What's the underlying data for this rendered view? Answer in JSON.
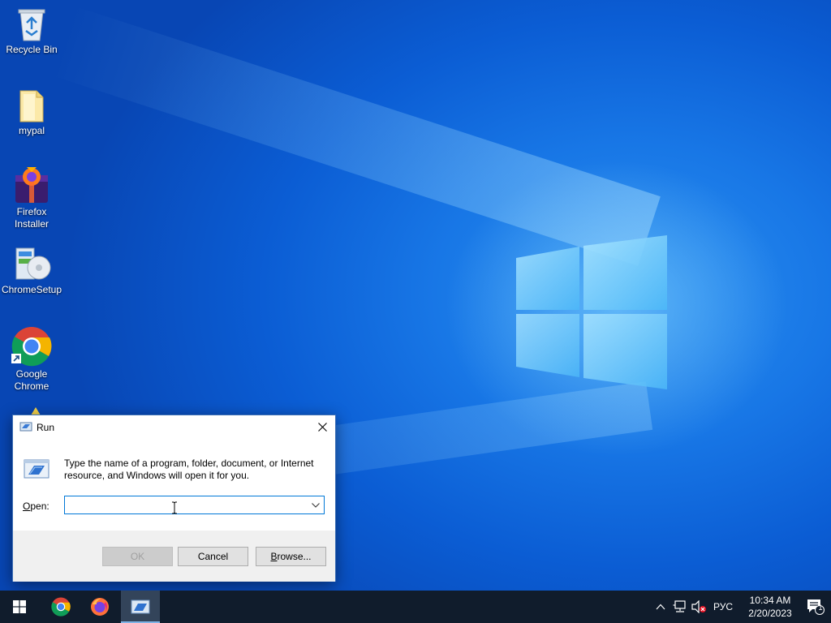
{
  "desktop": {
    "icons": [
      {
        "label": "Recycle Bin",
        "icon": "recycle-bin-icon"
      },
      {
        "label": "mypal",
        "icon": "folder-icon"
      },
      {
        "label": "Firefox Installer",
        "icon": "firefox-installer-icon"
      },
      {
        "label": "ChromeSetup",
        "icon": "chrome-setup-icon"
      },
      {
        "label": "Google Chrome",
        "icon": "google-chrome-icon"
      }
    ]
  },
  "run_dialog": {
    "title": "Run",
    "description": "Type the name of a program, folder, document, or Internet resource, and Windows will open it for you.",
    "open_label_mnemonic": "O",
    "open_label_rest": "pen:",
    "open_value": "",
    "ok_label": "OK",
    "cancel_label": "Cancel",
    "browse_label_mnemonic": "B",
    "browse_label_rest": "rowse...",
    "ok_enabled": false
  },
  "taskbar": {
    "apps": [
      {
        "name": "Google Chrome",
        "icon": "chrome-icon"
      },
      {
        "name": "Firefox",
        "icon": "firefox-icon"
      },
      {
        "name": "Run",
        "icon": "run-icon",
        "active": true
      }
    ],
    "tray": {
      "language": "РУС",
      "time": "10:34 AM",
      "date": "2/20/2023",
      "notification_count": "1"
    }
  },
  "colors": {
    "taskbar_bg": "#101c2c",
    "accent": "#0078d7",
    "wallpaper": "#0b5dd4"
  }
}
